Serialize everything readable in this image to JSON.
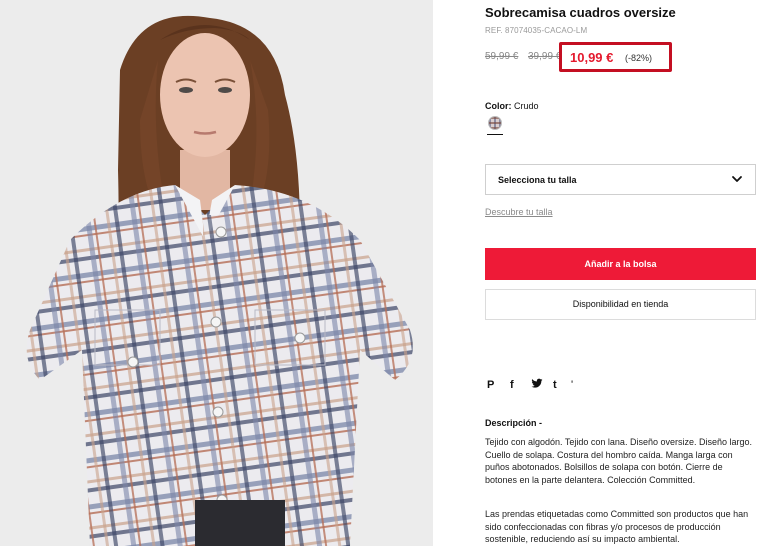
{
  "product": {
    "title": "Sobrecamisa cuadros oversize",
    "ref": "REF. 87074035-CACAO-LM",
    "price_original": "59,99 €",
    "price_previous": "39,99 €",
    "price_current": "10,99 €",
    "discount": "(-82%)"
  },
  "color": {
    "label": "Color:",
    "value": "Crudo"
  },
  "size": {
    "select_label": "Selecciona tu talla",
    "discover_link": "Descubre tu talla"
  },
  "actions": {
    "add_to_bag": "Añadir a la bolsa",
    "store_availability": "Disponibilidad en tienda"
  },
  "share": {
    "pinterest": "P",
    "facebook": "f",
    "twitter": "t",
    "tumblr": "t",
    "more": "'"
  },
  "description": {
    "title": "Descripción -",
    "p1": "Tejido con algodón. Tejido con lana. Diseño oversize. Diseño largo. Cuello de solapa. Costura del hombro caída. Manga larga con puños abotonados. Bolsillos de solapa con botón. Cierre de botones en la parte delantera. Colección Committed.",
    "p2": "Las prendas etiquetadas como Committed son productos que han sido confeccionadas con fibras y/o procesos de producción sostenible, reduciendo así su impacto ambiental."
  },
  "colors": {
    "sale_red": "#e4192d",
    "button_red": "#ee1a37",
    "highlight_border": "#c40f22"
  }
}
